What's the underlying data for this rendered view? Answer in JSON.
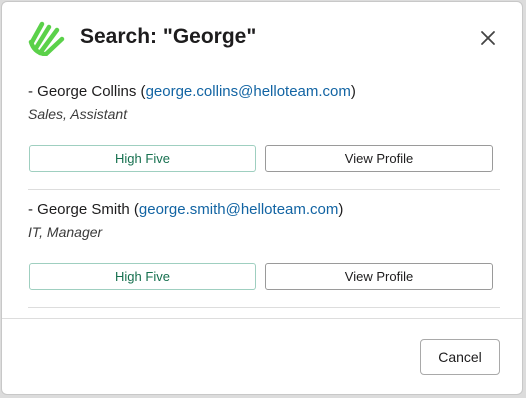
{
  "dialog": {
    "title": "Search: \"George\"",
    "logo_icon": "hand-wave-logo-icon",
    "close_icon": "close-icon",
    "accent_color": "#5bd14a"
  },
  "results": [
    {
      "prefix": "- ",
      "name": "George Collins",
      "email": "george.collins@helloteam.com",
      "role": "Sales, Assistant",
      "high_five_label": "High Five",
      "view_profile_label": "View Profile"
    },
    {
      "prefix": "- ",
      "name": "George Smith",
      "email": "george.smith@helloteam.com",
      "role": "IT, Manager",
      "high_five_label": "High Five",
      "view_profile_label": "View Profile"
    }
  ],
  "footer": {
    "cancel_label": "Cancel"
  }
}
